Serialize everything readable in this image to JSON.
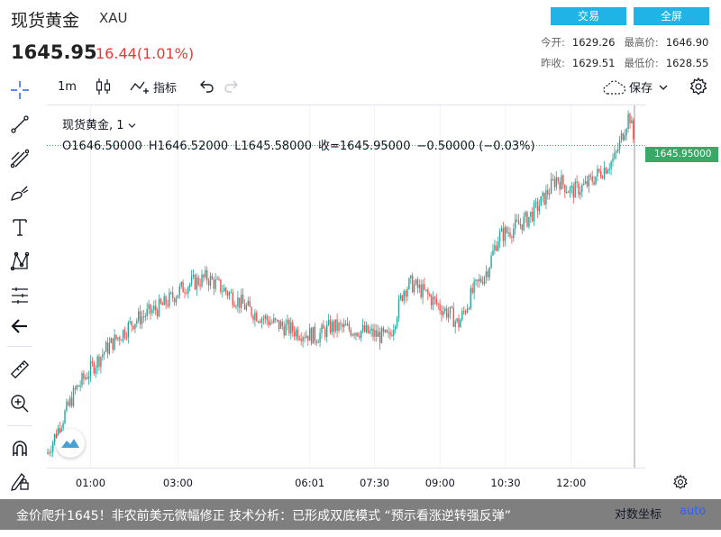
{
  "header": {
    "symbol_name": "现货黄金",
    "symbol_code": "XAU",
    "last_price": "1645.95",
    "change": "16.44",
    "change_pct": "(1.01%)",
    "trade_button": "交易",
    "fullscreen_button": "全屏",
    "stats": {
      "open_label": "今开:",
      "open": "1629.26",
      "high_label": "最高价:",
      "high": "1646.90",
      "prev_close_label": "昨收:",
      "prev_close": "1629.51",
      "low_label": "最低价:",
      "low": "1628.55"
    }
  },
  "toolbar": {
    "interval": "1m",
    "indicators_label": "指标",
    "save_label": "保存"
  },
  "legend": {
    "title": "现货黄金, 1",
    "open": "O1646.50000",
    "high": "H1646.52000",
    "low": "L1645.58000",
    "close": "收=1645.95000",
    "change": "−0.50000 (−0.03%)"
  },
  "price_badge": "1645.95000",
  "colors": {
    "accent_button": "#20b3e6",
    "up": "#26a69a",
    "down": "#ef5350",
    "price_line": "#3aa866",
    "change_red": "#e53935"
  },
  "chart_data": {
    "type": "line",
    "x_ticks": [
      "01:00",
      "03:00",
      "06:01",
      "07:30",
      "09:00",
      "10:30",
      "12:00"
    ],
    "series": [
      {
        "x": [
          "00:00",
          "00:40",
          "01:20",
          "02:00",
          "02:40",
          "03:10",
          "03:40",
          "04:10",
          "04:40",
          "05:10",
          "05:40",
          "06:10",
          "06:30",
          "06:50",
          "07:10",
          "07:30",
          "07:50",
          "08:10",
          "08:20",
          "08:40",
          "09:00",
          "09:15",
          "09:25",
          "09:45",
          "10:05",
          "10:20",
          "10:40",
          "11:00",
          "11:20",
          "11:40",
          "12:00",
          "12:20",
          "12:40",
          "13:00",
          "13:20",
          "13:27"
        ],
        "y": [
          1630.2,
          1633.5,
          1635.5,
          1637.0,
          1637.8,
          1638.8,
          1639.2,
          1638.4,
          1637.5,
          1636.9,
          1636.5,
          1636.2,
          1636.7,
          1636.6,
          1636.5,
          1636.3,
          1636.1,
          1638.6,
          1638.9,
          1638.4,
          1637.7,
          1637.3,
          1636.8,
          1638.5,
          1639.6,
          1641.3,
          1641.7,
          1642.2,
          1643.1,
          1644.3,
          1643.6,
          1643.9,
          1644.6,
          1645.3,
          1647.6,
          1645.95
        ]
      }
    ],
    "ylim": [
      1629.5,
      1648.0
    ],
    "last_value": 1645.95
  },
  "bottom_bar": {
    "log_scale_label": "对数坐标",
    "auto_label": "auto"
  },
  "banner": {
    "text": "金价爬升1645！非农前美元微幅修正 技术分析：已形成双底模式 “预示看涨逆转强反弹”"
  },
  "icons": [
    "crosshair-icon",
    "trend-line-icon",
    "fib-icon",
    "brush-icon",
    "text-icon",
    "pattern-icon",
    "measure-icon",
    "arrow-left-icon",
    "ruler-icon",
    "zoom-in-icon",
    "magnet-icon",
    "pencil-lock-icon",
    "candles-icon",
    "indicator-icon",
    "undo-icon",
    "redo-icon",
    "cloud-icon",
    "chevron-down-icon",
    "gear-icon",
    "tradingview-logo-icon"
  ]
}
